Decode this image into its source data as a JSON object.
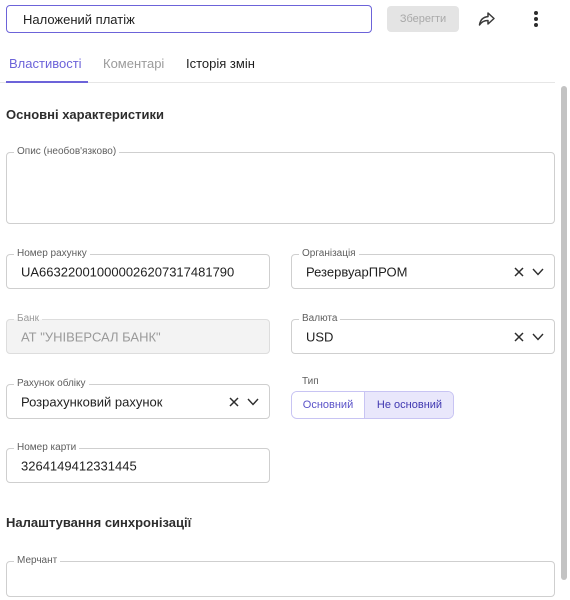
{
  "header": {
    "name_value": "Наложений платіж",
    "save_label": "Зберегти",
    "share_icon": "share-arrow-icon",
    "more_icon": "more-vertical-icon"
  },
  "tabs": [
    {
      "label": "Властивості",
      "state": "active"
    },
    {
      "label": "Коментарі",
      "state": "muted"
    },
    {
      "label": "Історія змін",
      "state": "normal"
    }
  ],
  "sections": {
    "main": "Основні характеристики",
    "sync": "Налаштування синхронізації"
  },
  "fields": {
    "description": {
      "label": "Опис (необов'язково)",
      "value": ""
    },
    "account_number": {
      "label": "Номер рахунку",
      "value": "UA663220010000026207317481790"
    },
    "organization": {
      "label": "Організація",
      "value": "РезервуарПРОМ"
    },
    "bank": {
      "label": "Банк",
      "value": "АТ \"УНІВЕРСАЛ БАНК\""
    },
    "currency": {
      "label": "Валюта",
      "value": "USD"
    },
    "accounting_account": {
      "label": "Рахунок обліку",
      "value": "Розрахунковий рахунок"
    },
    "card_number": {
      "label": "Номер карти",
      "value": "3264149412331445"
    },
    "merchant": {
      "label": "Мерчант",
      "value": ""
    }
  },
  "type_toggle": {
    "label": "Тип",
    "options": [
      "Основний",
      "Не основний"
    ],
    "selected": "Не основний"
  },
  "colors": {
    "accent": "#6c63d9",
    "toggle_selected_bg": "#e9e7fb"
  }
}
